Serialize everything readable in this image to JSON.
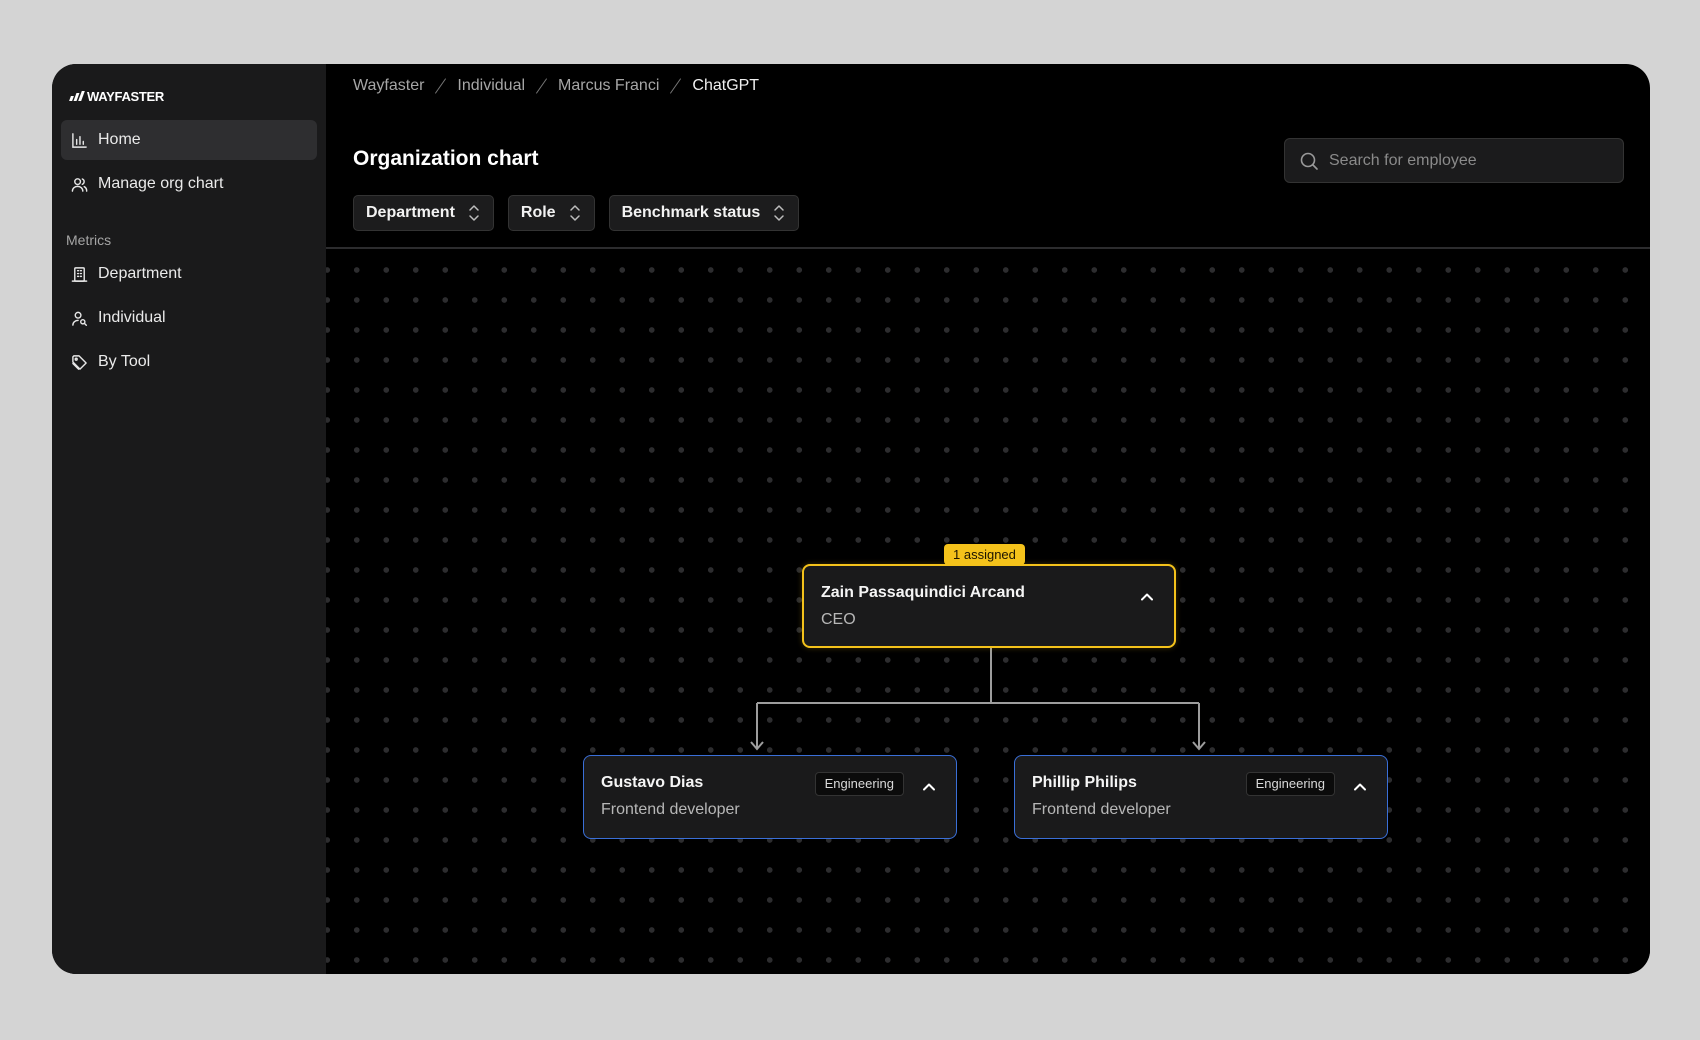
{
  "brand": {
    "name": "WAYFASTER"
  },
  "sidebar": {
    "items": [
      {
        "label": "Home",
        "icon": "bar-chart-icon",
        "active": true
      },
      {
        "label": "Manage org chart",
        "icon": "users-icon",
        "active": false
      }
    ],
    "section_label": "Metrics",
    "metrics_items": [
      {
        "label": "Department",
        "icon": "building-icon"
      },
      {
        "label": "Individual",
        "icon": "user-search-icon"
      },
      {
        "label": "By Tool",
        "icon": "tag-icon"
      }
    ]
  },
  "breadcrumb": [
    "Wayfaster",
    "Individual",
    "Marcus Franci",
    "ChatGPT"
  ],
  "header": {
    "title": "Organization chart",
    "search_placeholder": "Search for employee",
    "search_value": ""
  },
  "filters": [
    {
      "label": "Department"
    },
    {
      "label": "Role"
    },
    {
      "label": "Benchmark status"
    }
  ],
  "org_chart": {
    "root": {
      "name": "Zain Passaquindici Arcand",
      "role": "CEO",
      "badge": "1 assigned",
      "accent": "#f4c21b"
    },
    "children": [
      {
        "name": "Gustavo Dias",
        "role": "Frontend developer",
        "department": "Engineering",
        "accent": "#3a6fd8"
      },
      {
        "name": "Phillip Philips",
        "role": "Frontend developer",
        "department": "Engineering",
        "accent": "#3a6fd8"
      }
    ]
  },
  "colors": {
    "page_bg": "#d4d4d4",
    "app_bg": "#000000",
    "sidebar_bg": "#1a1a1b",
    "ceo_accent": "#f4c21b",
    "employee_accent": "#3a6fd8"
  }
}
